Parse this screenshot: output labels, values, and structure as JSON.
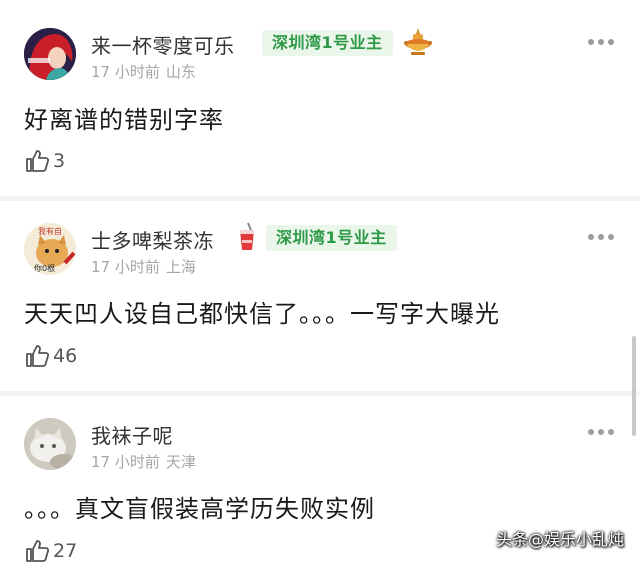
{
  "comments": [
    {
      "name": "来一杯零度可乐",
      "badge": "深圳湾1号业主",
      "badge_icon": "golden-hotpot-icon",
      "time": "17 小时前",
      "location": "山东",
      "text": "好离谱的错别字率",
      "likes": "3",
      "avatar_icon": "mermaid-avatar"
    },
    {
      "name": "士多啤梨茶冻",
      "badge": "深圳湾1号业主",
      "name_icon": "drink-cup-icon",
      "time": "17 小时前",
      "location": "上海",
      "text": "天天凹人设自己都快信了。。。一写字大曝光",
      "likes": "46",
      "avatar_icon": "cat-meme-avatar",
      "avatar_text_top": "我有自",
      "avatar_text_bottom": "你0根"
    },
    {
      "name": "我袜子呢",
      "time": "17 小时前",
      "location": "天津",
      "text": "。。。真文盲假装高学历失败实例",
      "likes": "27",
      "avatar_icon": "cat-photo-avatar"
    }
  ],
  "watermark": "头条@娱乐小乱炖",
  "colors": {
    "badge_bg": "#e9f6e9",
    "badge_text": "#2e9a47",
    "meta_text": "#a6a6a6",
    "divider": "#f4f4f4"
  }
}
